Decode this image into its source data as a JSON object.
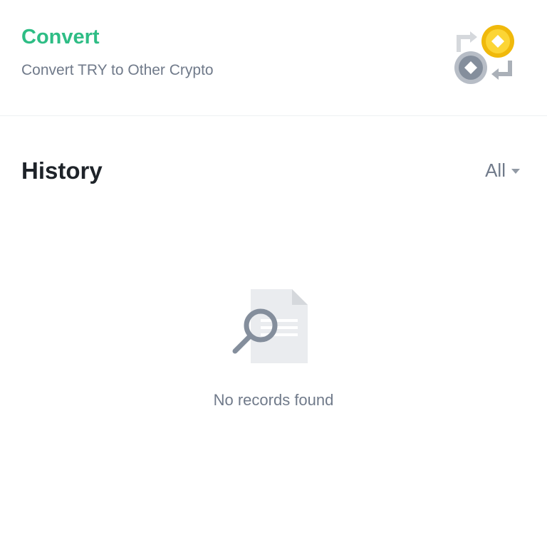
{
  "convert": {
    "title": "Convert",
    "subtitle": "Convert TRY to Other Crypto",
    "illustration_icon": "coin-swap-icon"
  },
  "history": {
    "title": "History",
    "filter": {
      "selected": "All",
      "icon": "caret-down-icon"
    }
  },
  "empty_state": {
    "icon": "no-records-search-icon",
    "message": "No records found"
  },
  "colors": {
    "accent_green": "#2ebd85",
    "coin_yellow": "#f0b90b",
    "text_primary": "#1e2329",
    "text_secondary": "#707a8a",
    "divider": "#eef0f3"
  }
}
